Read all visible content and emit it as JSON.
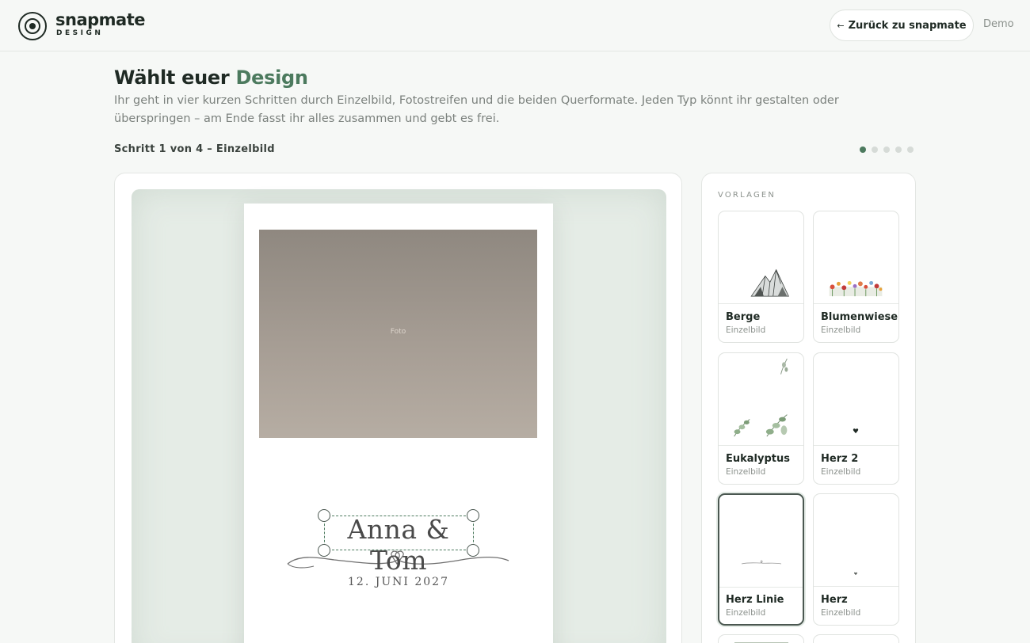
{
  "header": {
    "logo_name": "snapmate",
    "logo_sub": "DESIGN",
    "back_arrow": "←",
    "back_label": "Zurück zu snapmate",
    "demo_label": "Demo"
  },
  "intro": {
    "title_prefix": "Wählt euer",
    "title_accent": "Design",
    "description": "Ihr geht in vier kurzen Schritten durch Einzelbild, Fotostreifen und die beiden Querformate. Jeden Typ könnt ihr gestalten oder überspringen – am Ende fasst ihr alles zusammen und gebt es frei.",
    "step_label": "Schritt 1 von 4 – Einzelbild",
    "steps": {
      "total": 5,
      "current": 1
    }
  },
  "editor": {
    "photo_label": "Foto",
    "names_text": "Anna & Tom",
    "date_text": "12. JUNI 2027"
  },
  "templates": {
    "title": "VORLAGEN",
    "items": [
      {
        "name": "Berge",
        "type": "Einzelbild",
        "thumb": "mountain-icon",
        "selected": false
      },
      {
        "name": "Blumenwiese",
        "type": "Einzelbild",
        "thumb": "flower-meadow-icon",
        "selected": false
      },
      {
        "name": "Eukalyptus",
        "type": "Einzelbild",
        "thumb": "eucalyptus-icon",
        "selected": false
      },
      {
        "name": "Herz 2",
        "type": "Einzelbild",
        "thumb": "heart-dot-icon",
        "selected": false
      },
      {
        "name": "Herz Linie",
        "type": "Einzelbild",
        "thumb": "heart-line-icon",
        "selected": true
      },
      {
        "name": "Herz",
        "type": "Einzelbild",
        "thumb": "heart-small-icon",
        "selected": false
      }
    ]
  },
  "colors": {
    "accent": "#4c7a5e",
    "background": "#f6f8f6",
    "canvas": "#e5ece6",
    "text": "#1f2a24",
    "muted": "#8b918c"
  }
}
